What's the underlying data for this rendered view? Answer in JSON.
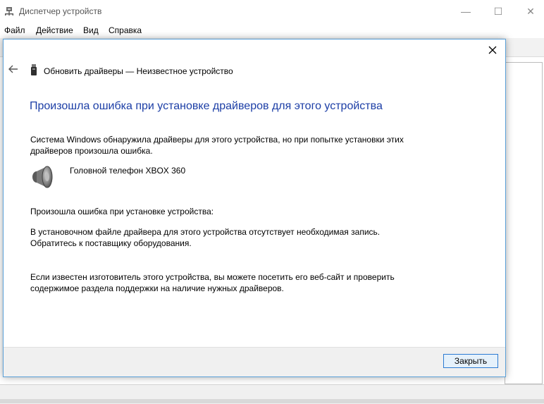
{
  "window": {
    "title": "Диспетчер устройств",
    "minimize_glyph": "—",
    "maximize_glyph": "☐",
    "close_glyph": "✕"
  },
  "menu": {
    "items": [
      {
        "label": "Файл"
      },
      {
        "label": "Действие"
      },
      {
        "label": "Вид"
      },
      {
        "label": "Справка"
      }
    ]
  },
  "dialog": {
    "title": "Обновить драйверы — Неизвестное устройство",
    "heading": "Произошла ошибка при установке драйверов для этого устройства",
    "intro": "Система Windows обнаружила драйверы для этого устройства, но при попытке установки этих драйверов произошла ошибка.",
    "device_name": "Головной телефон XBOX 360",
    "error_label": "Произошла ошибка при установке устройства:",
    "error_detail": "В установочном файле драйвера для этого устройства отсутствует необходимая запись. Обратитесь к поставщику оборудования.",
    "advice": "Если известен изготовитель этого устройства, вы можете посетить его веб-сайт и проверить содержимое раздела поддержки на наличие нужных драйверов.",
    "close_button": "Закрыть"
  },
  "icons": {
    "app": "device-manager-icon",
    "back": "back-arrow-icon",
    "device": "usb-device-icon",
    "speaker": "speaker-icon",
    "dialog_close": "close-icon"
  },
  "colors": {
    "heading": "#1c3ea6",
    "dialog_border": "#5aa0d8",
    "button_border": "#2b7ad2",
    "button_fill": "#e5f1fb"
  }
}
